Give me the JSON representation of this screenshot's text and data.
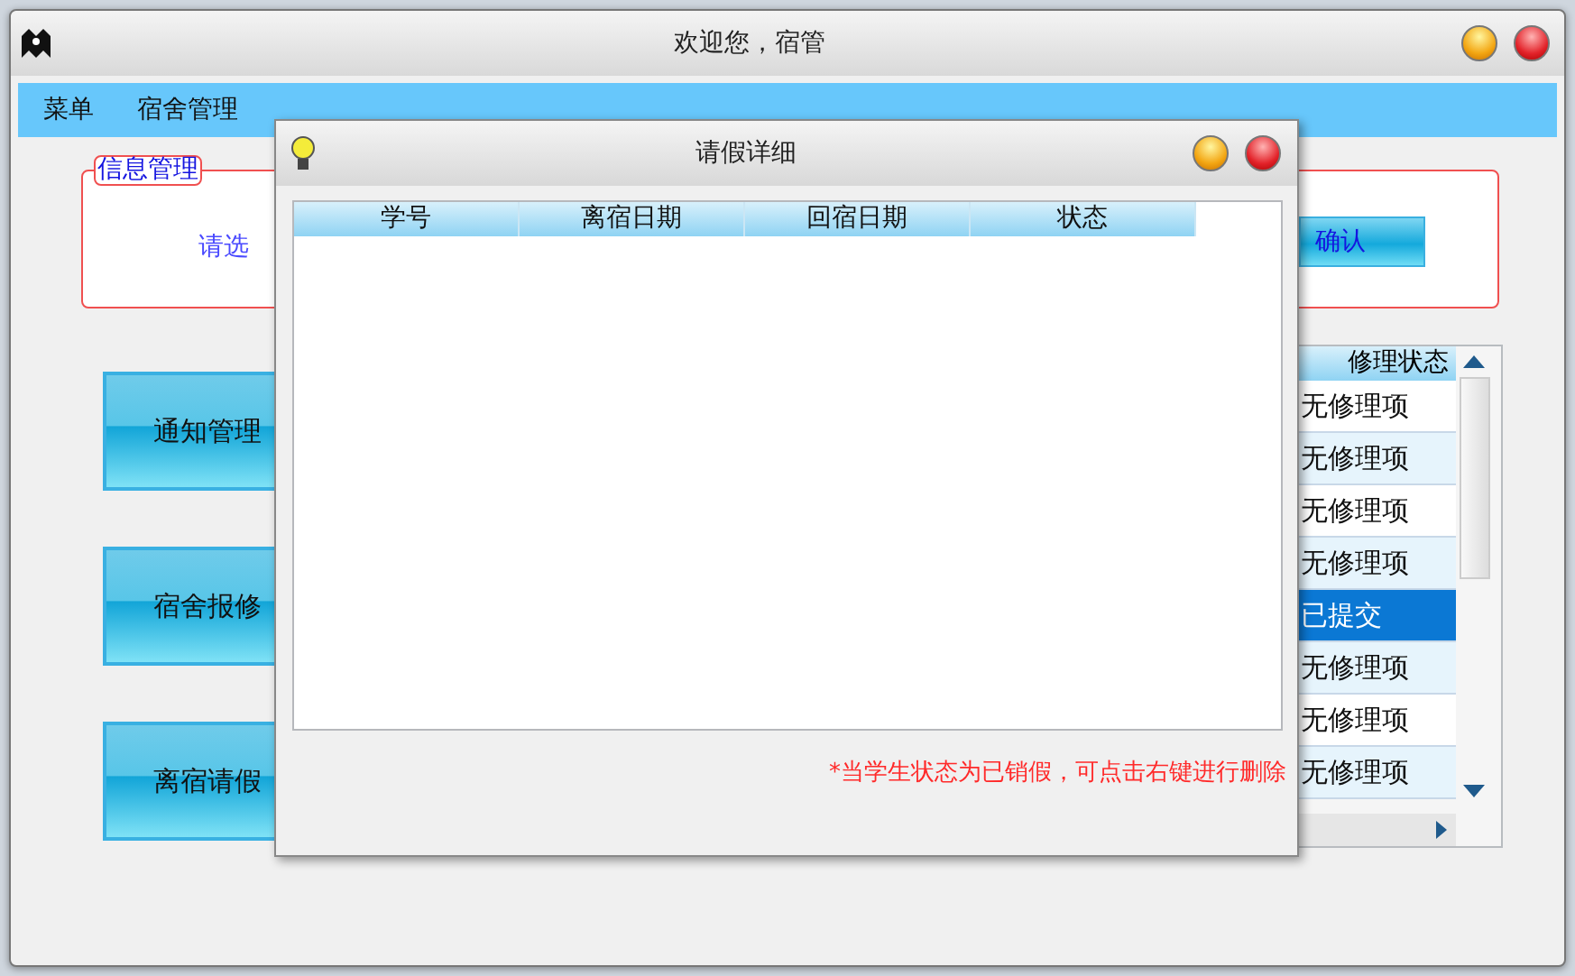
{
  "window": {
    "title": "欢迎您，宿管"
  },
  "menu": [
    {
      "label": "菜单"
    },
    {
      "label": "宿舍管理"
    }
  ],
  "info_group": {
    "title": "信息管理",
    "prompt": "请选",
    "confirm": "确认"
  },
  "nav_buttons": [
    {
      "label": "通知管理"
    },
    {
      "label": "宿舍报修"
    },
    {
      "label": "离宿请假"
    }
  ],
  "repair_table": {
    "column": "修理状态",
    "rows": [
      {
        "status": "无修理项",
        "selected": false
      },
      {
        "status": "无修理项",
        "selected": false
      },
      {
        "status": "无修理项",
        "selected": false
      },
      {
        "status": "无修理项",
        "selected": false
      },
      {
        "status": "已提交",
        "selected": true
      },
      {
        "status": "无修理项",
        "selected": false
      },
      {
        "status": "无修理项",
        "selected": false
      },
      {
        "status": "无修理项",
        "selected": false
      }
    ]
  },
  "dialog": {
    "title": "请假详细",
    "columns": [
      "学号",
      "离宿日期",
      "回宿日期",
      "状态"
    ],
    "note": "*当学生状态为已销假，可点击右键进行删除"
  }
}
